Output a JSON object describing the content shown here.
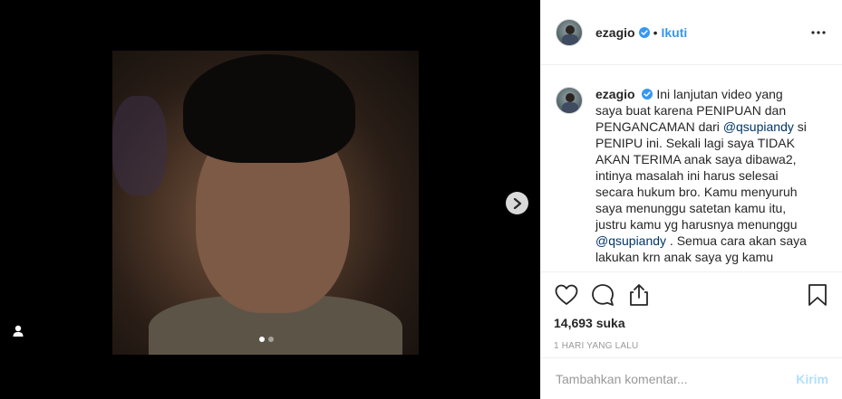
{
  "post": {
    "username": "ezagio",
    "separator": "•",
    "follow_label": "Ikuti",
    "more_icon": "more-horizontal-icon",
    "verified_icon": "verified-badge-icon"
  },
  "caption": {
    "username": "ezagio",
    "parts": [
      "Ini lanjutan video yang saya buat karena PENIPUAN dan PENGANCAMAN dari ",
      "@qsupiandy",
      " si PENIPU ini. Sekali lagi saya TIDAK AKAN TERIMA anak saya dibawa2, intinya masalah ini harus selesai secara hukum bro. Kamu menyuruh saya menunggu satetan kamu itu, justru kamu yg harusnya menunggu ",
      "@qsupiandy",
      " . Semua cara akan saya lakukan krn anak saya yg kamu"
    ]
  },
  "stats": {
    "likes": "14,693 suka",
    "date": "1 HARI YANG LALU"
  },
  "comment": {
    "placeholder": "Tambahkan komentar...",
    "post_label": "Kirim"
  },
  "media": {
    "carousel_dots": 2,
    "active_dot": 0,
    "next_icon": "chevron-right-icon",
    "tag_icon": "user-tag-icon"
  },
  "colors": {
    "link_blue": "#3897f0",
    "mention": "#003569",
    "post_disabled": "#b2dffc"
  }
}
